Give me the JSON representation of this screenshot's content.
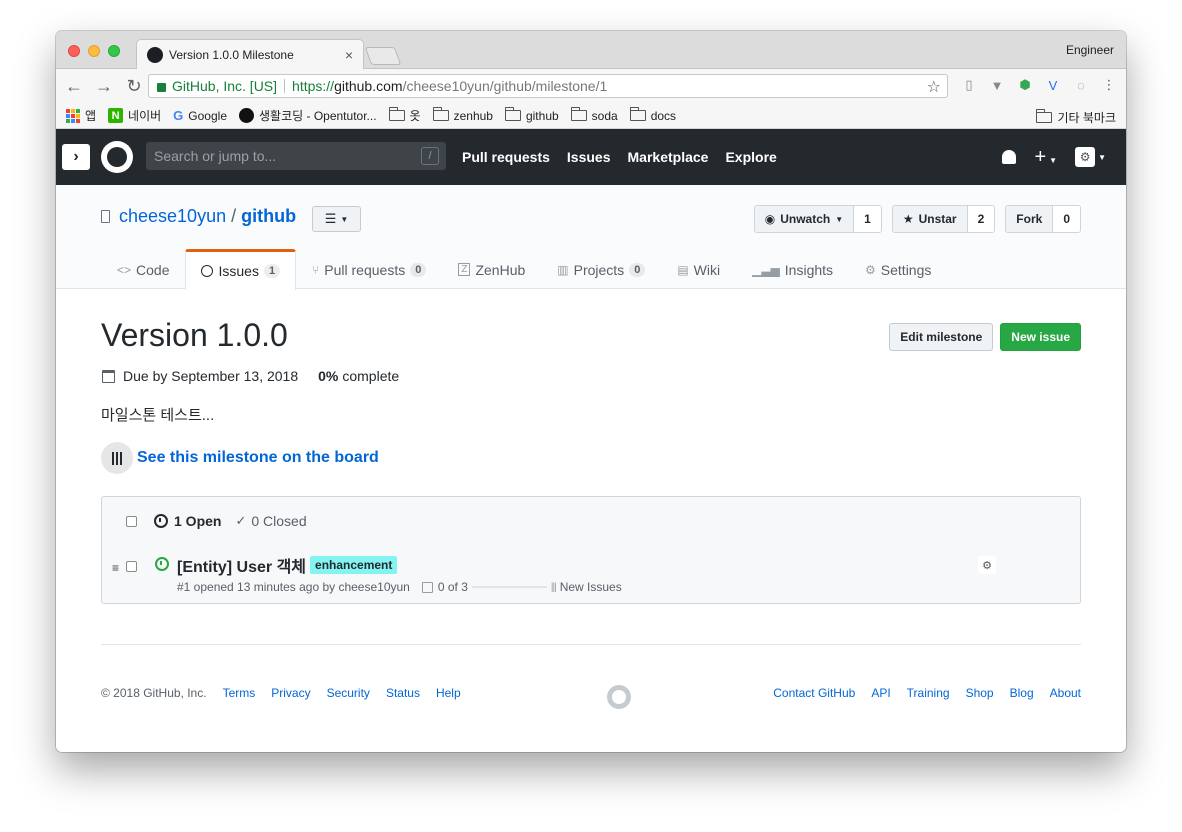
{
  "browser": {
    "tab_title": "Version 1.0.0 Milestone",
    "tab_close": "×",
    "profile": "Engineer",
    "secure_label": "GitHub, Inc. [US]",
    "url_scheme": "https://",
    "url_host": "github.com",
    "url_path": "/cheese10yun/github/milestone/1",
    "bookmarks": [
      {
        "label": "앱",
        "icon": "apps-icon"
      },
      {
        "label": "네이버",
        "icon": "naver-icon"
      },
      {
        "label": "Google",
        "icon": "google-icon"
      },
      {
        "label": "생활코딩 - Opentutor...",
        "icon": "dot-icon"
      },
      {
        "label": "옷",
        "icon": "folder-icon"
      },
      {
        "label": "zenhub",
        "icon": "folder-icon"
      },
      {
        "label": "github",
        "icon": "folder-icon"
      },
      {
        "label": "soda",
        "icon": "folder-icon"
      },
      {
        "label": "docs",
        "icon": "folder-icon"
      }
    ],
    "other_bookmarks": "기타 북마크"
  },
  "gh_header": {
    "search_placeholder": "Search or jump to...",
    "search_shortcut": "/",
    "nav": [
      "Pull requests",
      "Issues",
      "Marketplace",
      "Explore"
    ]
  },
  "repo": {
    "owner": "cheese10yun",
    "separator": "/",
    "name": "github",
    "actions": {
      "watch_label": "Unwatch",
      "watch_count": "1",
      "star_label": "Unstar",
      "star_count": "2",
      "fork_label": "Fork",
      "fork_count": "0"
    },
    "tabs": [
      {
        "label": "Code",
        "icon": "code-icon",
        "counter": ""
      },
      {
        "label": "Issues",
        "icon": "issue-icon",
        "counter": "1"
      },
      {
        "label": "Pull requests",
        "icon": "pull-request-icon",
        "counter": "0"
      },
      {
        "label": "ZenHub",
        "icon": "zenhub-icon",
        "counter": ""
      },
      {
        "label": "Projects",
        "icon": "project-icon",
        "counter": "0"
      },
      {
        "label": "Wiki",
        "icon": "book-icon",
        "counter": ""
      },
      {
        "label": "Insights",
        "icon": "graph-icon",
        "counter": ""
      },
      {
        "label": "Settings",
        "icon": "gear-icon",
        "counter": ""
      }
    ]
  },
  "milestone": {
    "title": "Version 1.0.0",
    "edit_label": "Edit milestone",
    "new_issue_label": "New issue",
    "due": "Due by September 13, 2018",
    "complete_pct": "0%",
    "complete_label": "complete",
    "description": "마일스톤 테스트...",
    "board_link": "See this milestone on the board",
    "open_count": "1 Open",
    "closed_count": "0 Closed"
  },
  "issues": [
    {
      "title": "[Entity] User 객체",
      "label": "enhancement",
      "label_color": "#84f4f2",
      "meta": "#1 opened 13 minutes ago by cheese10yun",
      "tasks": "0 of 3",
      "pipeline": "New Issues"
    }
  ],
  "footer": {
    "copyright": "© 2018 GitHub, Inc.",
    "left_links": [
      "Terms",
      "Privacy",
      "Security",
      "Status",
      "Help"
    ],
    "right_links": [
      "Contact GitHub",
      "API",
      "Training",
      "Shop",
      "Blog",
      "About"
    ]
  },
  "colors": {
    "header_bg": "#24292e",
    "link": "#0366d6",
    "primary_button": "#28a745",
    "active_tab_accent": "#e36209"
  }
}
